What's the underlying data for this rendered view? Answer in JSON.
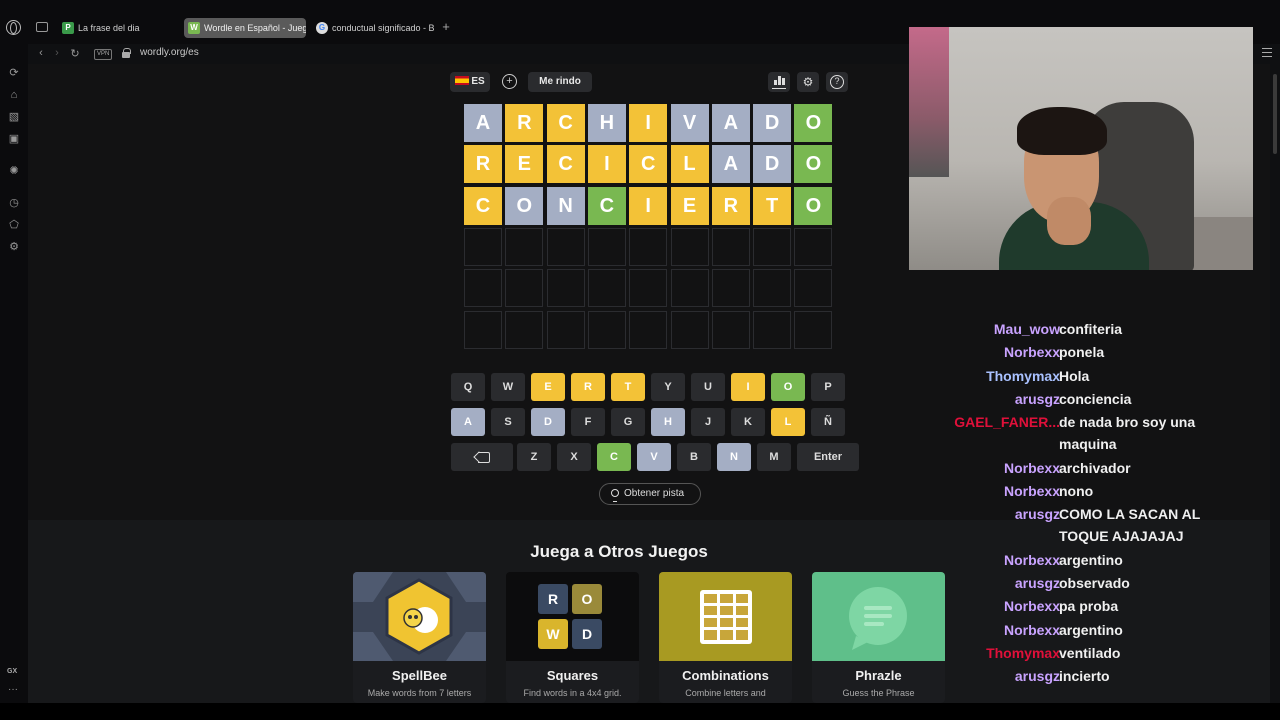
{
  "browser": {
    "tabs": [
      {
        "label": "La frase del dia",
        "favicon": "P",
        "active": false
      },
      {
        "label": "Wordle en Español - Jueg",
        "favicon": "W",
        "active": true
      },
      {
        "label": "conductual significado - B",
        "favicon": "G",
        "active": false
      }
    ],
    "url": "wordly.org/es",
    "vpn_label": "VPN"
  },
  "game": {
    "language_label": "ES",
    "give_up_label": "Me rindo",
    "hint_label": "Obtener pista",
    "rows": [
      {
        "letters": [
          "A",
          "R",
          "C",
          "H",
          "I",
          "V",
          "A",
          "D",
          "O"
        ],
        "states": [
          "a",
          "p",
          "p",
          "a",
          "p",
          "a",
          "a",
          "a",
          "c"
        ]
      },
      {
        "letters": [
          "R",
          "E",
          "C",
          "I",
          "C",
          "L",
          "A",
          "D",
          "O"
        ],
        "states": [
          "p",
          "p",
          "p",
          "p",
          "p",
          "p",
          "a",
          "a",
          "c"
        ]
      },
      {
        "letters": [
          "C",
          "O",
          "N",
          "C",
          "I",
          "E",
          "R",
          "T",
          "O"
        ],
        "states": [
          "p",
          "a",
          "a",
          "c",
          "p",
          "p",
          "p",
          "p",
          "c"
        ]
      },
      {
        "letters": [
          "",
          "",
          "",
          "",
          "",
          "",
          "",
          "",
          ""
        ],
        "states": [
          "e",
          "e",
          "e",
          "e",
          "e",
          "e",
          "e",
          "e",
          "e"
        ]
      },
      {
        "letters": [
          "",
          "",
          "",
          "",
          "",
          "",
          "",
          "",
          ""
        ],
        "states": [
          "e",
          "e",
          "e",
          "e",
          "e",
          "e",
          "e",
          "e",
          "e"
        ]
      },
      {
        "letters": [
          "",
          "",
          "",
          "",
          "",
          "",
          "",
          "",
          ""
        ],
        "states": [
          "e",
          "e",
          "e",
          "e",
          "e",
          "e",
          "e",
          "e",
          "e"
        ]
      }
    ],
    "keyboard": [
      [
        {
          "k": "Q",
          "s": ""
        },
        {
          "k": "W",
          "s": ""
        },
        {
          "k": "E",
          "s": "p"
        },
        {
          "k": "R",
          "s": "p"
        },
        {
          "k": "T",
          "s": "p"
        },
        {
          "k": "Y",
          "s": ""
        },
        {
          "k": "U",
          "s": ""
        },
        {
          "k": "I",
          "s": "p"
        },
        {
          "k": "O",
          "s": "c"
        },
        {
          "k": "P",
          "s": ""
        }
      ],
      [
        {
          "k": "A",
          "s": "a"
        },
        {
          "k": "S",
          "s": ""
        },
        {
          "k": "D",
          "s": "a"
        },
        {
          "k": "F",
          "s": ""
        },
        {
          "k": "G",
          "s": ""
        },
        {
          "k": "H",
          "s": "a"
        },
        {
          "k": "J",
          "s": ""
        },
        {
          "k": "K",
          "s": ""
        },
        {
          "k": "L",
          "s": "p"
        },
        {
          "k": "Ñ",
          "s": ""
        }
      ],
      [
        {
          "k": "⌫",
          "s": "",
          "wide": true
        },
        {
          "k": "Z",
          "s": ""
        },
        {
          "k": "X",
          "s": ""
        },
        {
          "k": "C",
          "s": "c"
        },
        {
          "k": "V",
          "s": "a"
        },
        {
          "k": "B",
          "s": ""
        },
        {
          "k": "N",
          "s": "a"
        },
        {
          "k": "M",
          "s": ""
        },
        {
          "k": "Enter",
          "s": "",
          "wide": true
        }
      ]
    ],
    "colors": {
      "correct": "#79b851",
      "present": "#f3c237",
      "absent": "#a4aec4",
      "key": "#2a2b2e"
    }
  },
  "others": {
    "title": "Juega a Otros Juegos",
    "cards": [
      {
        "name": "SpellBee",
        "desc": "Make words from 7 letters"
      },
      {
        "name": "Squares",
        "desc": "Find words in a 4x4 grid.",
        "tiles": [
          "R",
          "O",
          "W",
          "D"
        ]
      },
      {
        "name": "Combinations",
        "desc": "Combine letters and"
      },
      {
        "name": "Phrazle",
        "desc": "Guess the Phrase"
      }
    ]
  },
  "chat": [
    {
      "user": "Mau_wow",
      "color": "#c9a3ff",
      "text": "confiteria"
    },
    {
      "user": "Norbexx",
      "color": "#c9a3ff",
      "text": "ponela"
    },
    {
      "user": "Thomymax",
      "color": "#a9c1ff",
      "text": "Hola"
    },
    {
      "user": "arusgz",
      "color": "#c9a3ff",
      "text": "conciencia"
    },
    {
      "user": "GAEL_FANER...",
      "color": "#e0103a",
      "text": "de nada bro soy una maquina"
    },
    {
      "user": "Norbexx",
      "color": "#c9a3ff",
      "text": "archivador"
    },
    {
      "user": "Norbexx",
      "color": "#c9a3ff",
      "text": "nono"
    },
    {
      "user": "arusgz",
      "color": "#c9a3ff",
      "text": "COMO LA SACAN AL TOQUE AJAJAJAJ"
    },
    {
      "user": "Norbexx",
      "color": "#c9a3ff",
      "text": "argentino"
    },
    {
      "user": "arusgz",
      "color": "#c9a3ff",
      "text": "observado"
    },
    {
      "user": "Norbexx",
      "color": "#c9a3ff",
      "text": "pa proba"
    },
    {
      "user": "Norbexx",
      "color": "#c9a3ff",
      "text": "argentino"
    },
    {
      "user": "Thomymax",
      "color": "#e0103a",
      "text": "ventilado"
    },
    {
      "user": "arusgz",
      "color": "#c9a3ff",
      "text": "incierto"
    }
  ]
}
